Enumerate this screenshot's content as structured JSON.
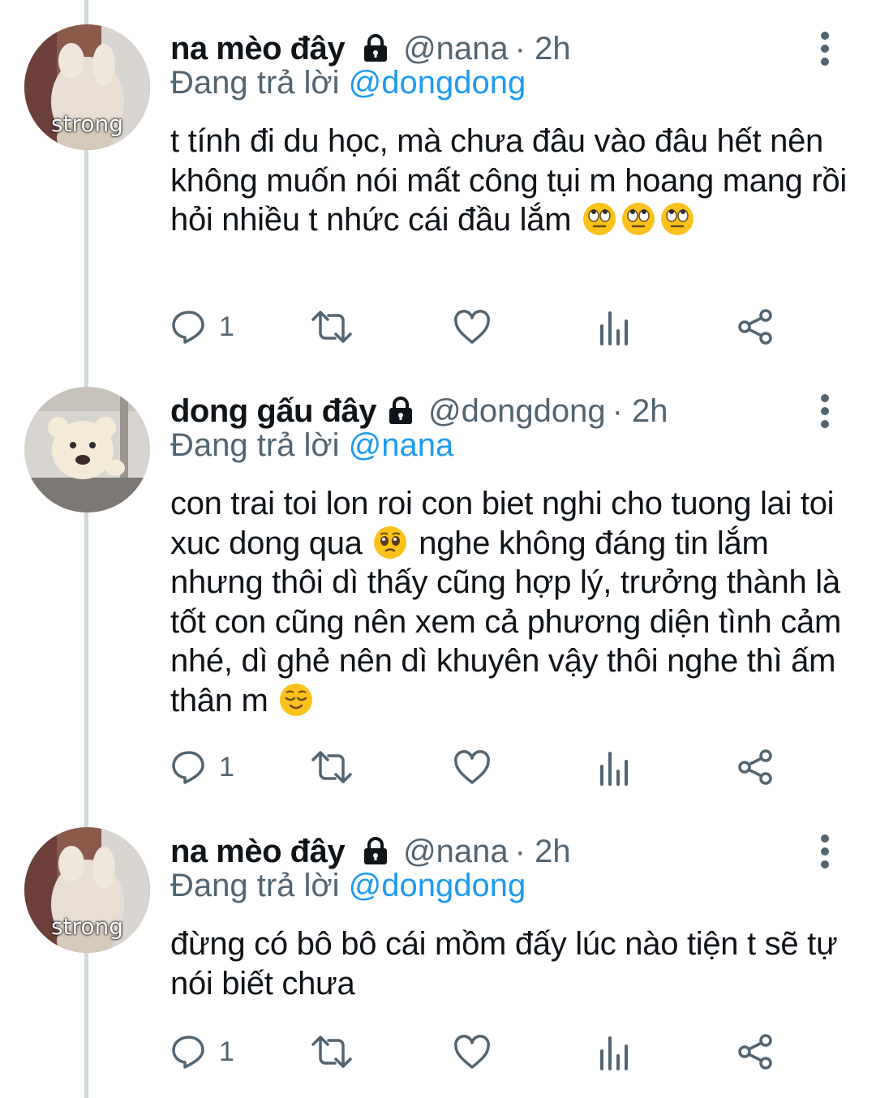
{
  "colors": {
    "accent": "#1d9bf0",
    "muted": "#536471",
    "text": "#0f1419",
    "thread_line": "#cfd9de"
  },
  "tweets": [
    {
      "name": "na mèo đây",
      "handle": "@nana",
      "time": "· 2h",
      "reply_prefix": "Đang trả lời",
      "reply_mention": "@dongdong",
      "avatar_caption": "strong",
      "text_parts": [
        "t tính đi du học, mà chưa đâu vào đâu hết nên không muốn nói mất công tụi m hoang mang rồi hỏi nhiều t nhức cái đầu lắm"
      ],
      "emojis": [
        "eye-roll-emoji",
        "eye-roll-emoji",
        "eye-roll-emoji"
      ],
      "reply_count": "1"
    },
    {
      "name": "dong gấu đây",
      "handle": "@dongdong",
      "time": "· 2h",
      "reply_prefix": "Đang trả lời",
      "reply_mention": "@nana",
      "avatar_caption": "",
      "text_parts": [
        "con trai toi lon roi con biet nghi cho tuong lai toi xuc dong qua",
        "nghe không đáng tin lắm nhưng thôi dì thấy cũng hợp lý, trưởng thành là tốt con cũng nên xem cả phương diện tình cảm nhé, dì ghẻ nên dì khuyên vậy thôi nghe thì ấm thân m"
      ],
      "emojis": [
        "teary-emoji",
        "relieved-emoji"
      ],
      "reply_count": "1"
    },
    {
      "name": "na mèo đây",
      "handle": "@nana",
      "time": "· 2h",
      "reply_prefix": "Đang trả lời",
      "reply_mention": "@dongdong",
      "avatar_caption": "strong",
      "text_parts": [
        "đừng có bô bô cái mồm đấy lúc nào tiện t sẽ tự nói biết chưa"
      ],
      "emojis": [],
      "reply_count": "1"
    }
  ],
  "icons": [
    "lock-icon",
    "more-icon",
    "reply-icon",
    "retweet-icon",
    "like-icon",
    "analytics-icon",
    "share-icon"
  ]
}
